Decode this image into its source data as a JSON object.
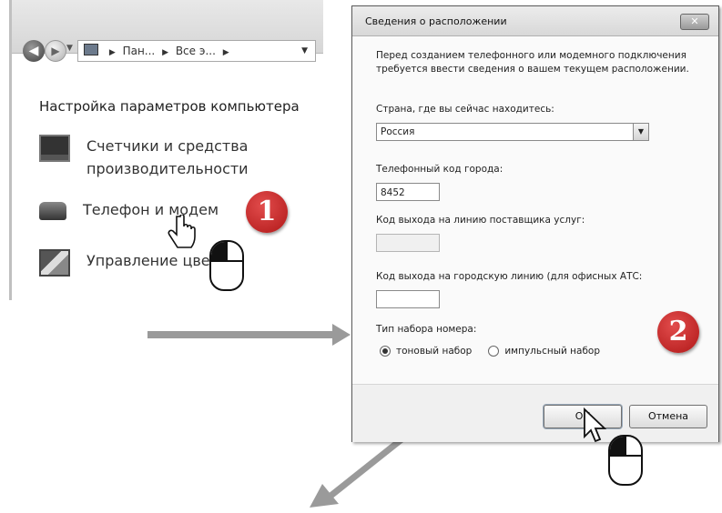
{
  "control_panel": {
    "breadcrumb": [
      "Пан...",
      "Все э...",
      ""
    ],
    "title": "Настройка параметров компьютера",
    "items": [
      {
        "label_line1": "Счетчики и средства",
        "label_line2": "производительности",
        "icon": "performance-icon"
      },
      {
        "label_line1": "Телефон и модем",
        "label_line2": "",
        "icon": "phone-modem-icon"
      },
      {
        "label_line1": "Управление цве",
        "label_line2": "",
        "icon": "color-management-icon"
      }
    ]
  },
  "steps": {
    "step1": "1",
    "step2": "2"
  },
  "dialog": {
    "title": "Сведения о расположении",
    "close_label": "✕",
    "intro": "Перед созданием телефонного или модемного подключения требуется ввести сведения о вашем текущем расположении.",
    "country_label": "Страна, где вы сейчас находитесь:",
    "country_value": "Россия",
    "area_code_label": "Телефонный код города:",
    "area_code_value": "8452",
    "carrier_label": "Код выхода на линию поставщика услуг:",
    "carrier_value": "",
    "outside_line_label": "Код выхода на городскую линию (для офисных АТС:",
    "outside_line_value": "",
    "dial_type_label": "Тип набора номера:",
    "dial_options": [
      "тоновый набор",
      "импульсный набор"
    ],
    "dial_selected": "тоновый набор",
    "ok_label": "ОК",
    "cancel_label": "Отмена"
  },
  "colors": {
    "badge": "#c62828",
    "arrow": "#9a9a9a"
  }
}
